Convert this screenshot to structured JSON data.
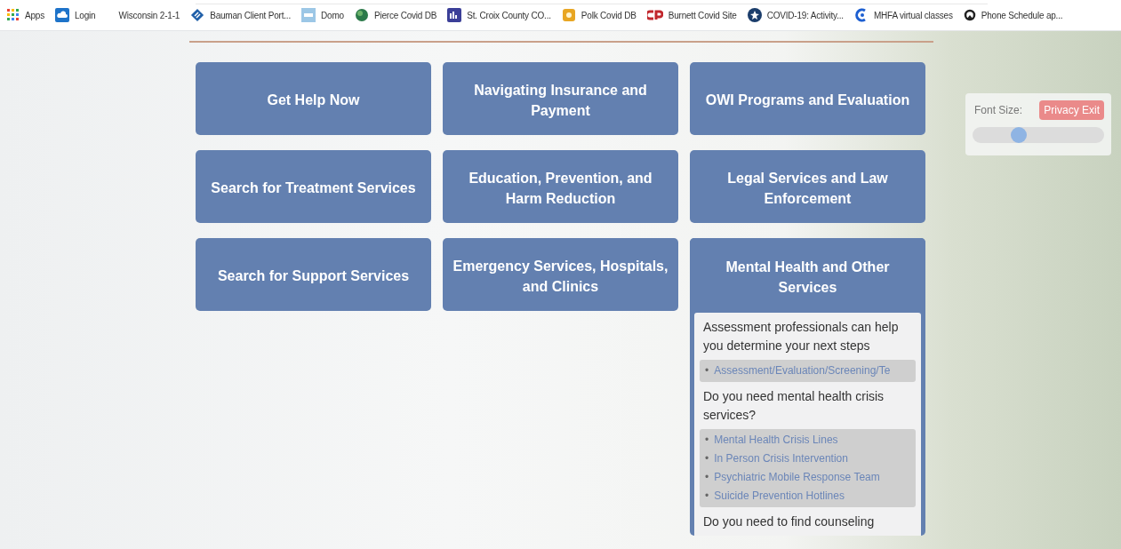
{
  "bookmarks": [
    {
      "label": "Apps",
      "kind": "apps"
    },
    {
      "label": "Login",
      "kind": "cloud"
    },
    {
      "label": "Wisconsin 2-1-1",
      "kind": "none"
    },
    {
      "label": "Bauman Client Port...",
      "kind": "diamond"
    },
    {
      "label": "Domo",
      "kind": "domo"
    },
    {
      "label": "Pierce Covid DB",
      "kind": "globe"
    },
    {
      "label": "St. Croix County CO...",
      "kind": "chart"
    },
    {
      "label": "Polk Covid DB",
      "kind": "badge"
    },
    {
      "label": "Burnett Covid Site",
      "kind": "cp"
    },
    {
      "label": "COVID-19: Activity...",
      "kind": "star"
    },
    {
      "label": "MHFA virtual classes",
      "kind": "swirl"
    },
    {
      "label": "Phone Schedule ap...",
      "kind": "ring"
    }
  ],
  "tiles": [
    {
      "label": "Get Help Now",
      "expanded": false
    },
    {
      "label": "Navigating Insurance and Payment",
      "expanded": false
    },
    {
      "label": "OWI Programs and Evaluation",
      "expanded": false
    },
    {
      "label": "Search for Treatment Services",
      "expanded": false
    },
    {
      "label": "Education, Prevention, and Harm Reduction",
      "expanded": false
    },
    {
      "label": "Legal Services and Law Enforcement",
      "expanded": false
    },
    {
      "label": "Search for Support Services",
      "expanded": false
    },
    {
      "label": "Emergency Services, Hospitals, and Clinics",
      "expanded": false
    },
    {
      "label": "Mental Health and Other Services",
      "expanded": true,
      "sections": [
        {
          "question": "Assessment professionals can help you determine your next steps",
          "bullet": "•",
          "links": [
            "Assessment/Evaluation/Screening/Te"
          ]
        },
        {
          "question": "Do you need mental health crisis services?",
          "bullet": "•",
          "links": [
            "Mental Health Crisis Lines",
            "In Person Crisis Intervention",
            "Psychiatric Mobile Response Team",
            "Suicide Prevention Hotlines"
          ]
        },
        {
          "question": "Do you need to find counseling"
        }
      ]
    }
  ],
  "font_size": {
    "label": "Font Size:",
    "level": 0.35
  },
  "privacy_exit": "Privacy Exit"
}
